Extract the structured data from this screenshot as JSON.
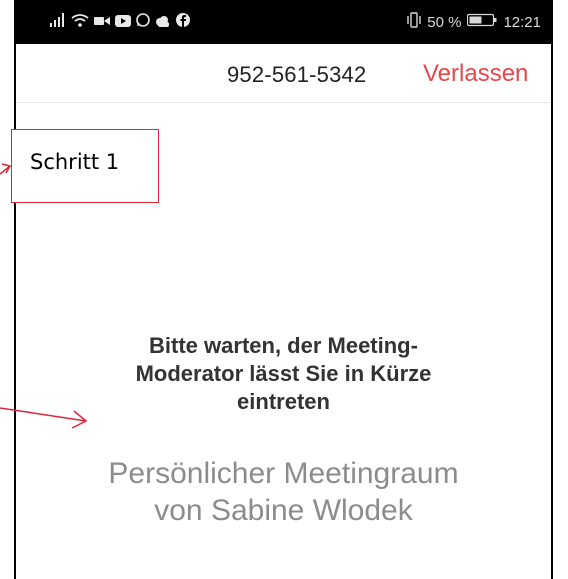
{
  "status_bar": {
    "left_icons": [
      "signal-icon",
      "wifi-icon",
      "video-icon",
      "youtube-icon",
      "whatsapp-icon",
      "cloud-icon",
      "facebook-icon"
    ],
    "vibrate_icon": "vibrate-icon",
    "battery_percent": "50 %",
    "battery_icon": "battery-icon",
    "time": "12:21"
  },
  "header": {
    "meeting_id": "952-561-5342",
    "leave_label": "Verlassen"
  },
  "annotation": {
    "label": "Schritt 1",
    "color": "#e0243a"
  },
  "waiting": {
    "message_lines": [
      "Bitte warten, der Meeting-",
      "Moderator lässt Sie in Kürze",
      "eintreten"
    ],
    "room_lines": [
      "Persönlicher Meetingraum",
      "von Sabine Wlodek"
    ]
  },
  "colors": {
    "accent": "#e8484b",
    "status_bar_bg": "#000000",
    "room_text": "#8c8c8c"
  }
}
